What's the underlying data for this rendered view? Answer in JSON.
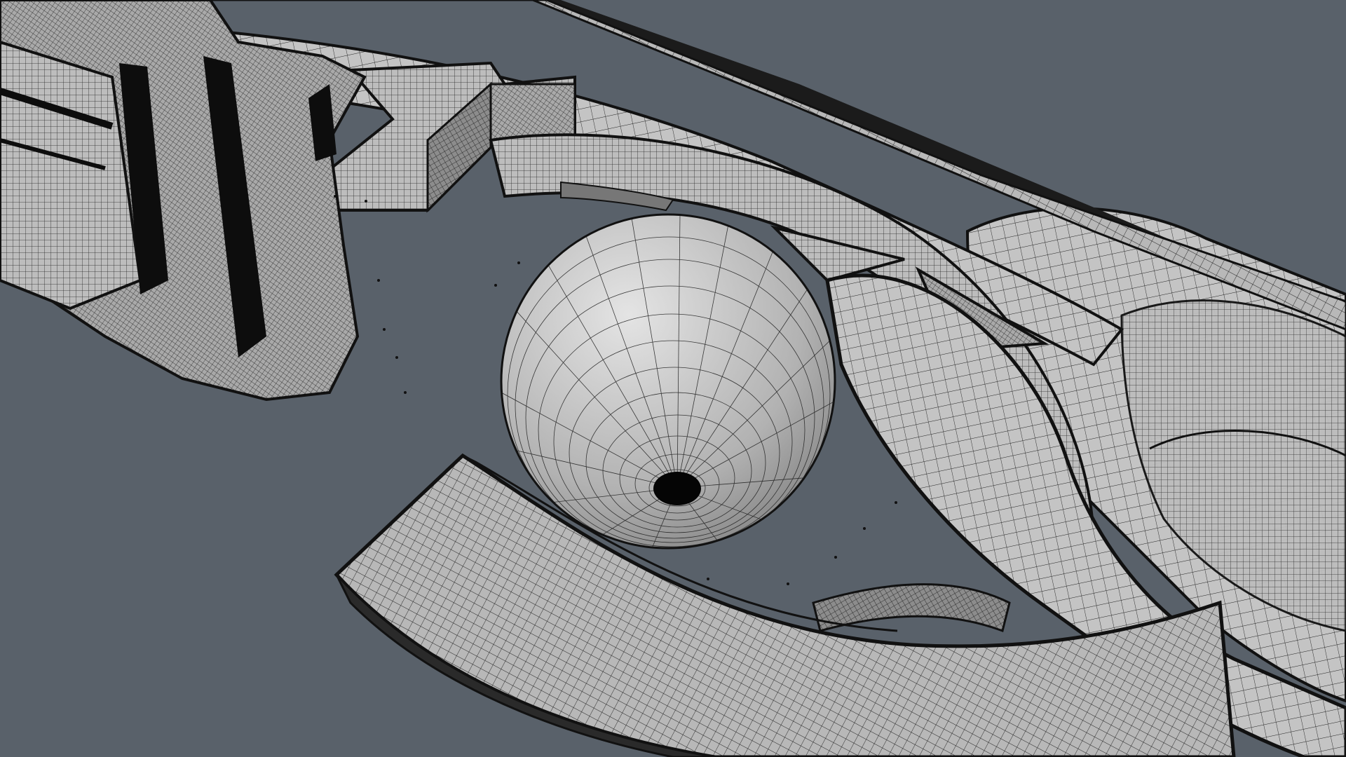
{
  "viewport": {
    "background_color": "#59616a",
    "render_mode": "wireframe-on-shaded",
    "mesh_fill_color": "#b9b9b9",
    "wire_color": "#1a1a1a"
  },
  "objects": [
    {
      "name": "eyeball-sphere",
      "kind": "uv-sphere",
      "iris": "dark-pupil-pole"
    },
    {
      "name": "lower-lid-arc",
      "kind": "curved-panel"
    },
    {
      "name": "upper-frame-arc",
      "kind": "curved-panel"
    },
    {
      "name": "inner-ring-band",
      "kind": "curved-band"
    },
    {
      "name": "left-segmented-cuff",
      "kind": "segmented-tube"
    },
    {
      "name": "top-bracket",
      "kind": "box-bracket"
    },
    {
      "name": "triangular-fins",
      "kind": "fins",
      "count": 2
    },
    {
      "name": "right-bulb-housing",
      "kind": "rounded-shell"
    }
  ]
}
